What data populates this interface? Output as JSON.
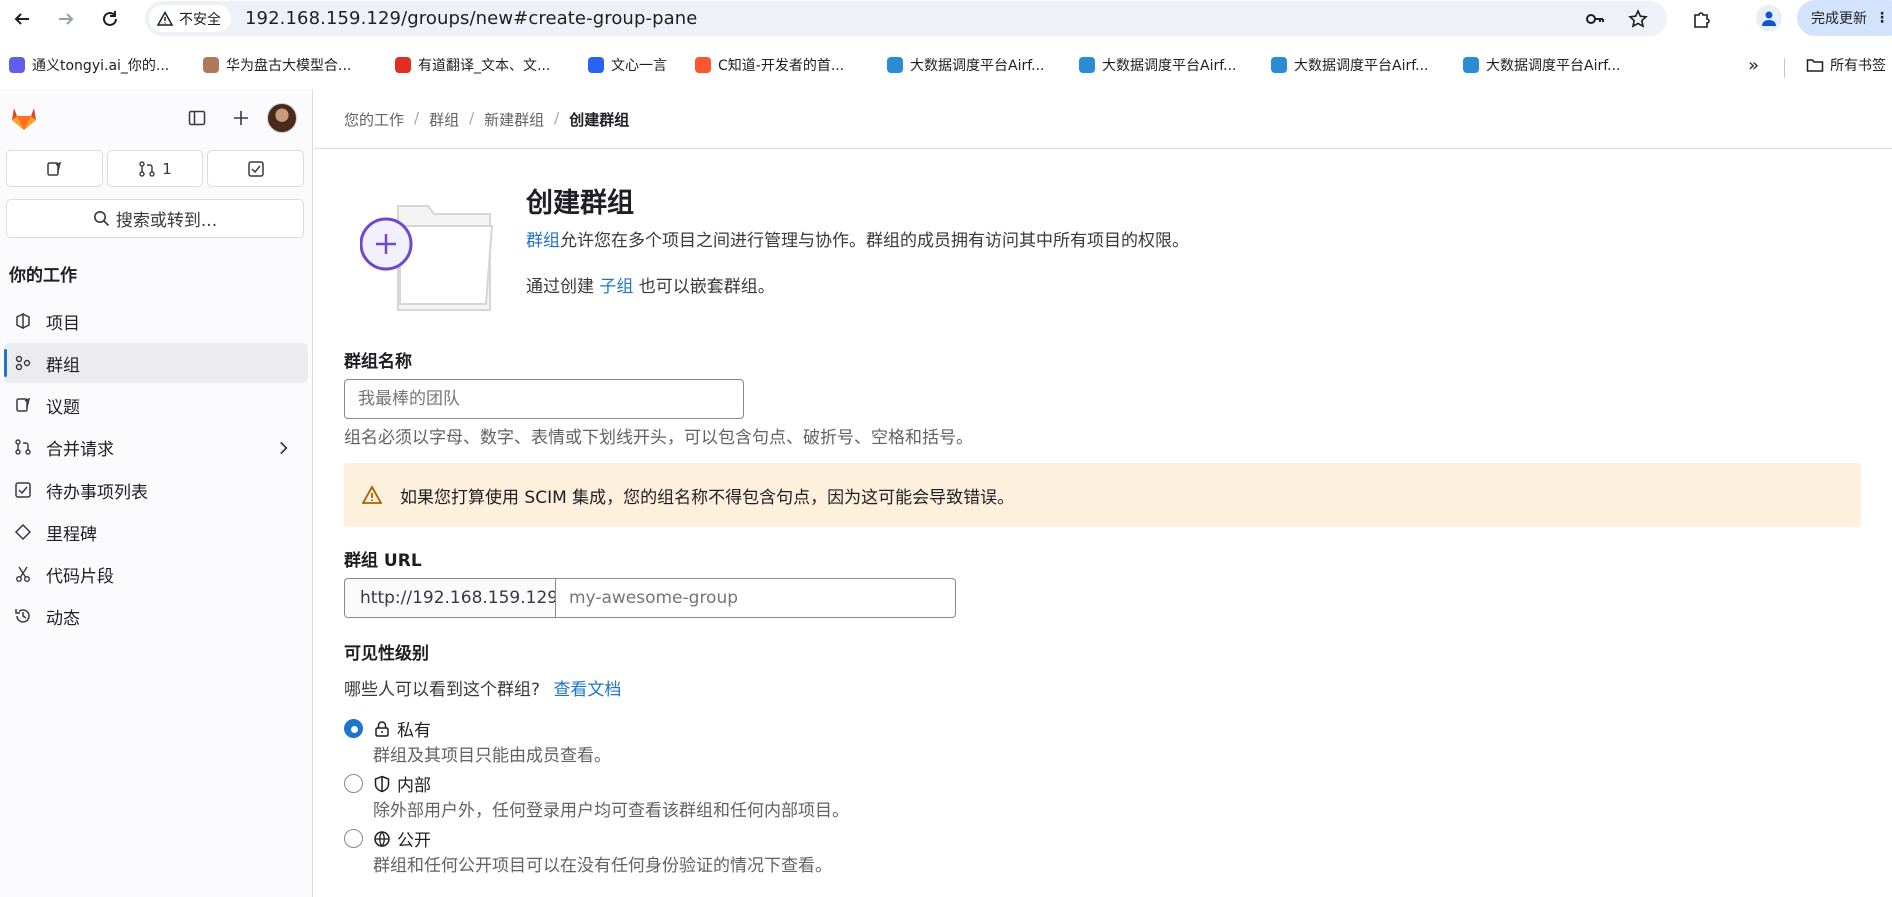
{
  "browser": {
    "insecure_label": "不安全",
    "url": "192.168.159.129/groups/new#create-group-pane",
    "update_label": "完成更新"
  },
  "bookmarks": [
    {
      "label": "通义tongyi.ai_你的...",
      "color": "#615ced"
    },
    {
      "label": "华为盘古大模型合...",
      "color": "#b07a5a"
    },
    {
      "label": "有道翻译_文本、文...",
      "color": "#e02e24"
    },
    {
      "label": "文心一言",
      "color": "#2a62f2"
    },
    {
      "label": "C知道-开发者的首...",
      "color": "#fc5531"
    },
    {
      "label": "大数据调度平台Airf...",
      "color": "#2b8bd6"
    },
    {
      "label": "大数据调度平台Airf...",
      "color": "#2b8bd6"
    },
    {
      "label": "大数据调度平台Airf...",
      "color": "#2b8bd6"
    },
    {
      "label": "大数据调度平台Airf...",
      "color": "#2b8bd6"
    }
  ],
  "bookmarks_more": "»",
  "bookmarks_folder": "所有书签",
  "sidebar": {
    "mr_count": "1",
    "search_label": "搜索或转到...",
    "section_title": "你的工作",
    "items": [
      {
        "label": "项目",
        "icon": "project-icon"
      },
      {
        "label": "群组",
        "icon": "group-icon",
        "active": true
      },
      {
        "label": "议题",
        "icon": "issues-icon"
      },
      {
        "label": "合并请求",
        "icon": "merge-request-icon"
      },
      {
        "label": "待办事项列表",
        "icon": "todo-icon"
      },
      {
        "label": "里程碑",
        "icon": "milestone-icon"
      },
      {
        "label": "代码片段",
        "icon": "snippet-icon"
      },
      {
        "label": "动态",
        "icon": "history-icon"
      }
    ]
  },
  "breadcrumb": {
    "items": [
      "您的工作",
      "群组",
      "新建群组"
    ],
    "current": "创建群组",
    "sep": "/"
  },
  "header": {
    "title": "创建群组",
    "desc_link": "群组",
    "desc_rest": "允许您在多个项目之间进行管理与协作。群组的成员拥有访问其中所有项目的权限。",
    "nest_prefix": "通过创建 ",
    "nest_link": "子组",
    "nest_suffix": " 也可以嵌套群组。"
  },
  "form": {
    "name_label": "群组名称",
    "name_placeholder": "我最棒的团队",
    "name_help": "组名必须以字母、数字、表情或下划线开头，可以包含句点、破折号、空格和括号。",
    "warning": "如果您打算使用 SCIM 集成，您的组名称不得包含句点，因为这可能会导致错误。",
    "url_label": "群组 URL",
    "url_prefix": "http://192.168.159.129/",
    "url_placeholder": "my-awesome-group",
    "visibility_label": "可见性级别",
    "visibility_question": "哪些人可以看到这个群组?",
    "visibility_doc_link": "查看文档",
    "options": [
      {
        "label": "私有",
        "desc": "群组及其项目只能由成员查看。",
        "checked": true
      },
      {
        "label": "内部",
        "desc": "除外部用户外，任何登录用户均可查看该群组和任何内部项目。",
        "checked": false
      },
      {
        "label": "公开",
        "desc": "群组和任何公开项目可以在没有任何身份验证的情况下查看。",
        "checked": false
      }
    ]
  }
}
